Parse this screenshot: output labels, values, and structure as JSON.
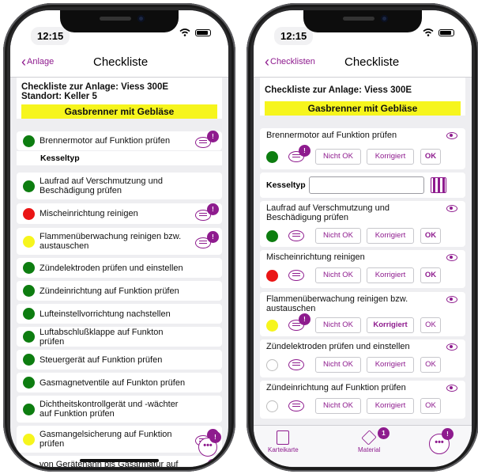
{
  "left": {
    "time": "12:15",
    "back_label": "Anlage",
    "title": "Checkliste",
    "header_line1": "Checkliste zur Anlage: Viess 300E",
    "header_line2": "Standort: Keller 5",
    "banner": "Gasbrenner mit Gebläse",
    "kesseltyp": "Kesseltyp",
    "items": [
      {
        "label": "Brennermotor auf Funktion prüfen",
        "status": "green",
        "comment": true,
        "badge": "!"
      },
      {
        "label": "Laufrad auf Verschmutzung und Beschädigung prüfen",
        "status": "green",
        "comment": false
      },
      {
        "label": "Mischeinrichtung reinigen",
        "status": "red",
        "comment": true,
        "badge": "!"
      },
      {
        "label": "Flammenüberwachung reinigen bzw. austauschen",
        "status": "yellow",
        "comment": true,
        "badge": "!"
      },
      {
        "label": "Zündelektroden prüfen und einstellen",
        "status": "green",
        "comment": false
      },
      {
        "label": "Zündeinrichtung auf Funktion prüfen",
        "status": "green",
        "comment": false
      },
      {
        "label": "Lufteinstellvorrichtung nachstellen",
        "status": "green",
        "comment": false
      },
      {
        "label": "Luftabschlußklappe auf Funkton prüfen",
        "status": "green",
        "comment": false
      },
      {
        "label": "Steuergerät auf Funktion prüfen",
        "status": "green",
        "comment": false
      },
      {
        "label": "Gasmagnetventile auf Funkton prüfen",
        "status": "green",
        "comment": false
      },
      {
        "label": "Dichtheitskontrollgerät und -wächter auf Funktion prüfen",
        "status": "green",
        "comment": false
      },
      {
        "label": "Gasmangelsicherung auf Funktion prüfen",
        "status": "yellow",
        "comment": true,
        "badge": "!"
      },
      {
        "label": "von Gerätehahn bis Gasarmatur auf Dichtheit prüfen",
        "status": "red",
        "comment": true,
        "badge": "!"
      }
    ],
    "fab_label": "•••",
    "fab_badge": "!"
  },
  "right": {
    "time": "12:15",
    "back_label": "Checklisten",
    "title": "Checkliste",
    "header_line1": "Checkliste zur Anlage: Viess 300E",
    "banner": "Gasbrenner mit Gebläse",
    "kesseltyp": "Kesseltyp",
    "btn_not_ok": "Nicht OK",
    "btn_corrected": "Korrigiert",
    "btn_ok": "OK",
    "items": [
      {
        "label": "Brennermotor auf Funktion prüfen",
        "status": "green",
        "badge": "!",
        "active": "ok"
      },
      {
        "label": "Laufrad auf Verschmutzung und Beschädigung prüfen",
        "status": "green",
        "active": "ok"
      },
      {
        "label": "Mischeinrichtung reinigen",
        "status": "red",
        "active": "ok"
      },
      {
        "label": "Flammenüberwachung reinigen bzw. austauschen",
        "status": "yellow",
        "badge": "!",
        "active": "corrected"
      },
      {
        "label": "Zündelektroden prüfen und einstellen",
        "status": "empty",
        "active": "none"
      },
      {
        "label": "Zündeinrichtung auf Funktion prüfen",
        "status": "empty",
        "active": "none"
      }
    ],
    "tabs": [
      {
        "label": "Karteikarte",
        "icon": "index-card-icon"
      },
      {
        "label": "Material",
        "icon": "box-icon",
        "badge": "1"
      }
    ],
    "fab_label": "•••",
    "fab_badge": "!"
  },
  "colors": {
    "accent": "#8e1b8e",
    "banner": "#f6f51d",
    "green": "#0d7d10",
    "red": "#ea1515",
    "yellow": "#f6f51d"
  }
}
